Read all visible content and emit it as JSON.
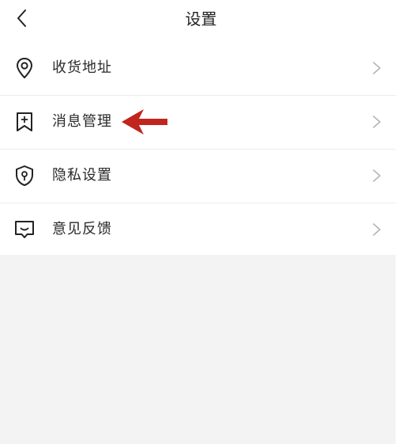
{
  "header": {
    "title": "设置",
    "back_icon": "chevron-left-icon"
  },
  "menu": {
    "items": [
      {
        "label": "收货地址",
        "icon": "location-pin-icon"
      },
      {
        "label": "消息管理",
        "icon": "bookmark-plus-icon"
      },
      {
        "label": "隐私设置",
        "icon": "shield-keyhole-icon"
      },
      {
        "label": "意见反馈",
        "icon": "chat-bubble-icon"
      }
    ],
    "chevron_icon": "chevron-right-icon"
  },
  "colors": {
    "background": "#ffffff",
    "empty_area": "#f3f3f3",
    "annotation_arrow": "#c0251e",
    "icon": "#222222",
    "chevron": "#b5b5b5"
  }
}
